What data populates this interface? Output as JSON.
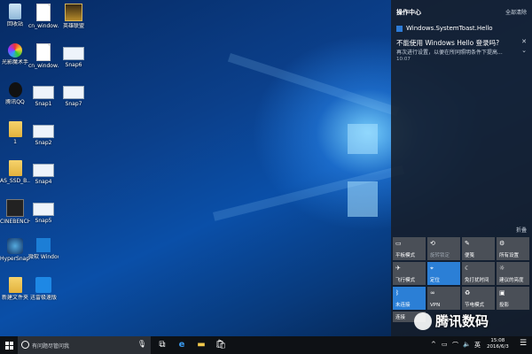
{
  "desktop_icons": [
    {
      "label": "回收站",
      "icon": "recycle-bin-icon"
    },
    {
      "label": "cn_window...",
      "icon": "document-icon"
    },
    {
      "label": "英雄联盟",
      "icon": "league-of-legends-icon"
    },
    {
      "label": "光影魔术手",
      "icon": "disc-app-icon"
    },
    {
      "label": "cn_window...",
      "icon": "document-icon"
    },
    {
      "label": "Snap6",
      "icon": "image-file-icon"
    },
    {
      "label": "腾讯QQ",
      "icon": "qq-penguin-icon"
    },
    {
      "label": "Snap1",
      "icon": "image-file-icon"
    },
    {
      "label": "Snap7",
      "icon": "image-file-icon"
    },
    {
      "label": "1",
      "icon": "folder-icon"
    },
    {
      "label": "Snap2",
      "icon": "image-file-icon"
    },
    {
      "label": "AS_SSD_B...",
      "icon": "folder-icon"
    },
    {
      "label": "Snap4",
      "icon": "image-file-icon"
    },
    {
      "label": "CINEBENCH R15",
      "icon": "cinebench-icon"
    },
    {
      "label": "Snap5",
      "icon": "image-file-icon"
    },
    {
      "label": "HyperSnap 6",
      "icon": "hypersnap-icon"
    },
    {
      "label": "微软 Windows ...",
      "icon": "windows-logo-icon"
    },
    {
      "label": "新建文件夹",
      "icon": "folder-icon"
    },
    {
      "label": "迅雷极速版",
      "icon": "thunder-bird-icon"
    }
  ],
  "action_center": {
    "title": "操作中心",
    "clear_all": "全部清除",
    "notification": {
      "app": "Windows.SystemToast.Hello",
      "title": "不能使用 Windows Hello 登录吗?",
      "body": "再次进行设置，以便在所同照明条件下提高...",
      "time": "10:07"
    },
    "collapse_label": "折叠",
    "quick_actions": [
      {
        "label": "平板模式",
        "icon": "tablet-mode-icon",
        "active": false,
        "dim": false
      },
      {
        "label": "旋转锁定",
        "icon": "rotation-lock-icon",
        "active": false,
        "dim": true
      },
      {
        "label": "便笺",
        "icon": "note-icon",
        "active": false,
        "dim": false
      },
      {
        "label": "所有设置",
        "icon": "settings-gear-icon",
        "active": false,
        "dim": false
      },
      {
        "label": "飞行模式",
        "icon": "airplane-icon",
        "active": false,
        "dim": false
      },
      {
        "label": "定位",
        "icon": "location-icon",
        "active": true,
        "dim": false
      },
      {
        "label": "免打扰时间",
        "icon": "moon-icon",
        "active": false,
        "dim": false
      },
      {
        "label": "建议的亮度",
        "icon": "brightness-icon",
        "active": false,
        "dim": false
      },
      {
        "label": "未连接",
        "icon": "bluetooth-icon",
        "active": true,
        "dim": false
      },
      {
        "label": "VPN",
        "icon": "vpn-icon",
        "active": false,
        "dim": false
      },
      {
        "label": "节电模式",
        "icon": "battery-saver-icon",
        "active": false,
        "dim": false
      },
      {
        "label": "投影",
        "icon": "project-icon",
        "active": false,
        "dim": false
      },
      {
        "label": "连接",
        "icon": "connect-icon",
        "active": false,
        "dim": false
      }
    ]
  },
  "watermark": "腾讯数码",
  "taskbar": {
    "search_placeholder": "有问题尽管问我",
    "clock_time": "15:08",
    "clock_date": "2016/6/3",
    "ime": "英"
  }
}
